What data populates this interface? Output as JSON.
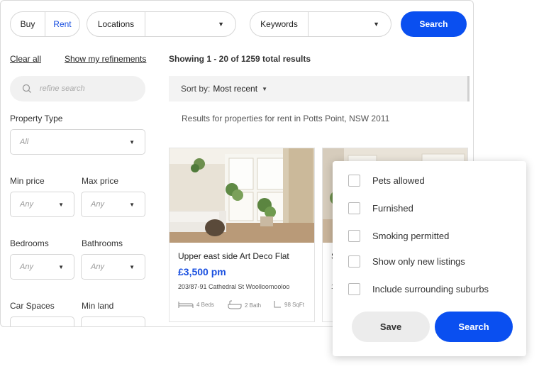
{
  "topbar": {
    "buy_label": "Buy",
    "rent_label": "Rent",
    "locations_label": "Locations",
    "keywords_label": "Keywords",
    "search_label": "Search"
  },
  "filters": {
    "clear_all": "Clear all",
    "show_refinements": "Show my refinements",
    "refine_placeholder": "refine search",
    "property_type_label": "Property Type",
    "property_type_value": "All",
    "min_price_label": "Min price",
    "min_price_value": "Any",
    "max_price_label": "Max price",
    "max_price_value": "Any",
    "bedrooms_label": "Bedrooms",
    "bedrooms_value": "Any",
    "bathrooms_label": "Bathrooms",
    "bathrooms_value": "Any",
    "car_spaces_label": "Car Spaces",
    "min_land_label": "Min land"
  },
  "results": {
    "showing_text": "Showing 1 - 20 of 1259 total results",
    "sort_label": "Sort by:",
    "sort_value": "Most recent",
    "results_for": "Results for properties for rent in Potts Point, NSW 2011"
  },
  "listings": [
    {
      "title": "Upper east side Art Deco Flat",
      "price": "£3,500 pm",
      "address": "203/87-91 Cathedral St Woolloomooloo",
      "beds": "4 Beds",
      "bath": "2 Bath",
      "size": "98 SqFt"
    },
    {
      "title": "S",
      "price": "",
      "address": "1",
      "beds": "",
      "bath": "",
      "size": ""
    }
  ],
  "popup": {
    "options": [
      {
        "label": "Pets allowed",
        "checked": false
      },
      {
        "label": "Furnished",
        "checked": false
      },
      {
        "label": "Smoking permitted",
        "checked": false
      },
      {
        "label": "Show only new listings",
        "checked": false
      },
      {
        "label": "Include surrounding suburbs",
        "checked": false
      }
    ],
    "save_label": "Save",
    "search_label": "Search"
  },
  "colors": {
    "accent": "#0a4ff0",
    "price": "#1a50e0"
  }
}
